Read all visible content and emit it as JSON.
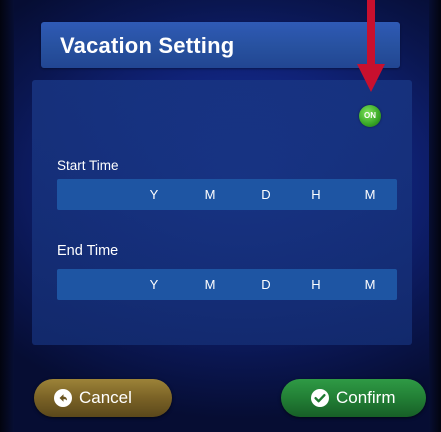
{
  "dialog": {
    "title": "Vacation Setting",
    "toggle_label": "ON",
    "toggle_state": "on"
  },
  "start_time": {
    "label": "Start Time",
    "units": [
      "Y",
      "M",
      "D",
      "H",
      "M"
    ]
  },
  "end_time": {
    "label": "End Time",
    "units": [
      "Y",
      "M",
      "D",
      "H",
      "M"
    ]
  },
  "buttons": {
    "cancel_label": "Cancel",
    "confirm_label": "Confirm"
  },
  "annotation": {
    "arrow_color": "#c8102e",
    "points_to": "on-toggle"
  },
  "colors": {
    "title_bar": "#2a56a8",
    "field_row": "#1e55a3",
    "toggle_on": "#3fae2a",
    "cancel_button": "#7a6226",
    "confirm_button": "#227f35"
  }
}
